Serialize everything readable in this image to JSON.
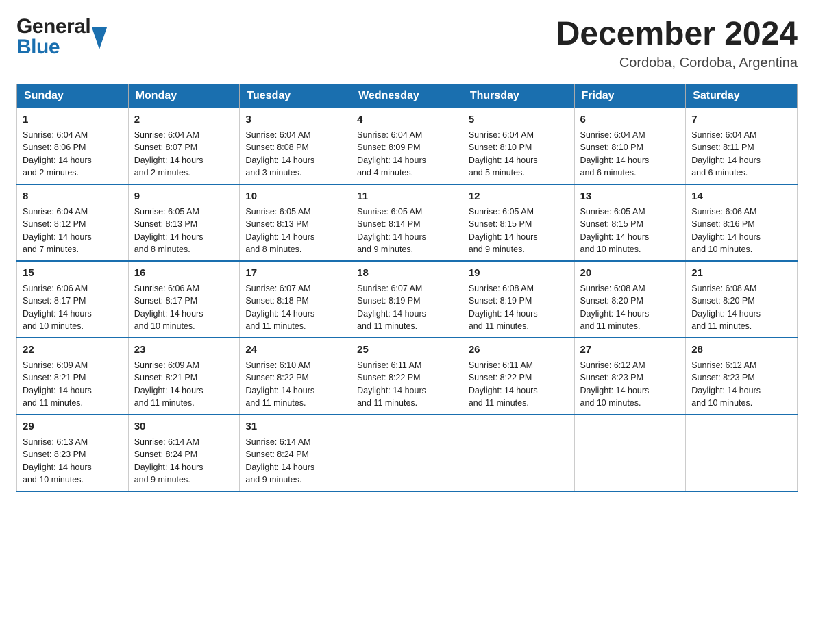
{
  "header": {
    "logo_general": "General",
    "logo_blue": "Blue",
    "month_title": "December 2024",
    "location": "Cordoba, Cordoba, Argentina"
  },
  "weekdays": [
    "Sunday",
    "Monday",
    "Tuesday",
    "Wednesday",
    "Thursday",
    "Friday",
    "Saturday"
  ],
  "weeks": [
    [
      {
        "day": "1",
        "sunrise": "6:04 AM",
        "sunset": "8:06 PM",
        "daylight": "14 hours and 2 minutes."
      },
      {
        "day": "2",
        "sunrise": "6:04 AM",
        "sunset": "8:07 PM",
        "daylight": "14 hours and 2 minutes."
      },
      {
        "day": "3",
        "sunrise": "6:04 AM",
        "sunset": "8:08 PM",
        "daylight": "14 hours and 3 minutes."
      },
      {
        "day": "4",
        "sunrise": "6:04 AM",
        "sunset": "8:09 PM",
        "daylight": "14 hours and 4 minutes."
      },
      {
        "day": "5",
        "sunrise": "6:04 AM",
        "sunset": "8:10 PM",
        "daylight": "14 hours and 5 minutes."
      },
      {
        "day": "6",
        "sunrise": "6:04 AM",
        "sunset": "8:10 PM",
        "daylight": "14 hours and 6 minutes."
      },
      {
        "day": "7",
        "sunrise": "6:04 AM",
        "sunset": "8:11 PM",
        "daylight": "14 hours and 6 minutes."
      }
    ],
    [
      {
        "day": "8",
        "sunrise": "6:04 AM",
        "sunset": "8:12 PM",
        "daylight": "14 hours and 7 minutes."
      },
      {
        "day": "9",
        "sunrise": "6:05 AM",
        "sunset": "8:13 PM",
        "daylight": "14 hours and 8 minutes."
      },
      {
        "day": "10",
        "sunrise": "6:05 AM",
        "sunset": "8:13 PM",
        "daylight": "14 hours and 8 minutes."
      },
      {
        "day": "11",
        "sunrise": "6:05 AM",
        "sunset": "8:14 PM",
        "daylight": "14 hours and 9 minutes."
      },
      {
        "day": "12",
        "sunrise": "6:05 AM",
        "sunset": "8:15 PM",
        "daylight": "14 hours and 9 minutes."
      },
      {
        "day": "13",
        "sunrise": "6:05 AM",
        "sunset": "8:15 PM",
        "daylight": "14 hours and 10 minutes."
      },
      {
        "day": "14",
        "sunrise": "6:06 AM",
        "sunset": "8:16 PM",
        "daylight": "14 hours and 10 minutes."
      }
    ],
    [
      {
        "day": "15",
        "sunrise": "6:06 AM",
        "sunset": "8:17 PM",
        "daylight": "14 hours and 10 minutes."
      },
      {
        "day": "16",
        "sunrise": "6:06 AM",
        "sunset": "8:17 PM",
        "daylight": "14 hours and 10 minutes."
      },
      {
        "day": "17",
        "sunrise": "6:07 AM",
        "sunset": "8:18 PM",
        "daylight": "14 hours and 11 minutes."
      },
      {
        "day": "18",
        "sunrise": "6:07 AM",
        "sunset": "8:19 PM",
        "daylight": "14 hours and 11 minutes."
      },
      {
        "day": "19",
        "sunrise": "6:08 AM",
        "sunset": "8:19 PM",
        "daylight": "14 hours and 11 minutes."
      },
      {
        "day": "20",
        "sunrise": "6:08 AM",
        "sunset": "8:20 PM",
        "daylight": "14 hours and 11 minutes."
      },
      {
        "day": "21",
        "sunrise": "6:08 AM",
        "sunset": "8:20 PM",
        "daylight": "14 hours and 11 minutes."
      }
    ],
    [
      {
        "day": "22",
        "sunrise": "6:09 AM",
        "sunset": "8:21 PM",
        "daylight": "14 hours and 11 minutes."
      },
      {
        "day": "23",
        "sunrise": "6:09 AM",
        "sunset": "8:21 PM",
        "daylight": "14 hours and 11 minutes."
      },
      {
        "day": "24",
        "sunrise": "6:10 AM",
        "sunset": "8:22 PM",
        "daylight": "14 hours and 11 minutes."
      },
      {
        "day": "25",
        "sunrise": "6:11 AM",
        "sunset": "8:22 PM",
        "daylight": "14 hours and 11 minutes."
      },
      {
        "day": "26",
        "sunrise": "6:11 AM",
        "sunset": "8:22 PM",
        "daylight": "14 hours and 11 minutes."
      },
      {
        "day": "27",
        "sunrise": "6:12 AM",
        "sunset": "8:23 PM",
        "daylight": "14 hours and 10 minutes."
      },
      {
        "day": "28",
        "sunrise": "6:12 AM",
        "sunset": "8:23 PM",
        "daylight": "14 hours and 10 minutes."
      }
    ],
    [
      {
        "day": "29",
        "sunrise": "6:13 AM",
        "sunset": "8:23 PM",
        "daylight": "14 hours and 10 minutes."
      },
      {
        "day": "30",
        "sunrise": "6:14 AM",
        "sunset": "8:24 PM",
        "daylight": "14 hours and 9 minutes."
      },
      {
        "day": "31",
        "sunrise": "6:14 AM",
        "sunset": "8:24 PM",
        "daylight": "14 hours and 9 minutes."
      },
      null,
      null,
      null,
      null
    ]
  ],
  "labels": {
    "sunrise": "Sunrise:",
    "sunset": "Sunset:",
    "daylight": "Daylight:"
  }
}
